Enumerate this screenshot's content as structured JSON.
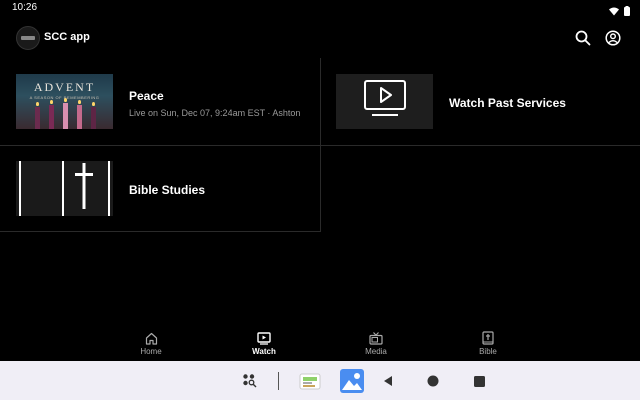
{
  "status_bar": {
    "time": "10:26",
    "icons": [
      "wifi-icon",
      "battery-icon"
    ]
  },
  "app_bar": {
    "title": "SCC app",
    "actions": [
      {
        "name": "search-icon"
      },
      {
        "name": "account-icon"
      }
    ]
  },
  "tiles": [
    {
      "title": "Peace",
      "subtitle": "Live on Sun, Dec 07, 9:24am EST · Ashton",
      "thumbnail": {
        "heading": "ADVENT",
        "subheading": "A SEASON OF REMEMBERING"
      }
    },
    {
      "title": "Watch Past Services",
      "subtitle": ""
    },
    {
      "title": "Bible Studies",
      "subtitle": ""
    }
  ],
  "bottom_nav": {
    "items": [
      {
        "label": "Home",
        "icon": "home-icon",
        "active": false
      },
      {
        "label": "Watch",
        "icon": "watch-icon",
        "active": true
      },
      {
        "label": "Media",
        "icon": "tv-icon",
        "active": false
      },
      {
        "label": "Bible",
        "icon": "bible-icon",
        "active": false
      }
    ]
  },
  "system_nav": {
    "items": [
      "app-drawer-icon",
      "recent-app-icon",
      "gallery-app-icon",
      "back-icon",
      "home-circle-icon",
      "overview-icon"
    ]
  },
  "colors": {
    "background": "#000000",
    "text": "#ffffff",
    "subtext": "#9a9a9a",
    "divider": "#2a2a2a",
    "system_bar": "#f0eef6"
  }
}
